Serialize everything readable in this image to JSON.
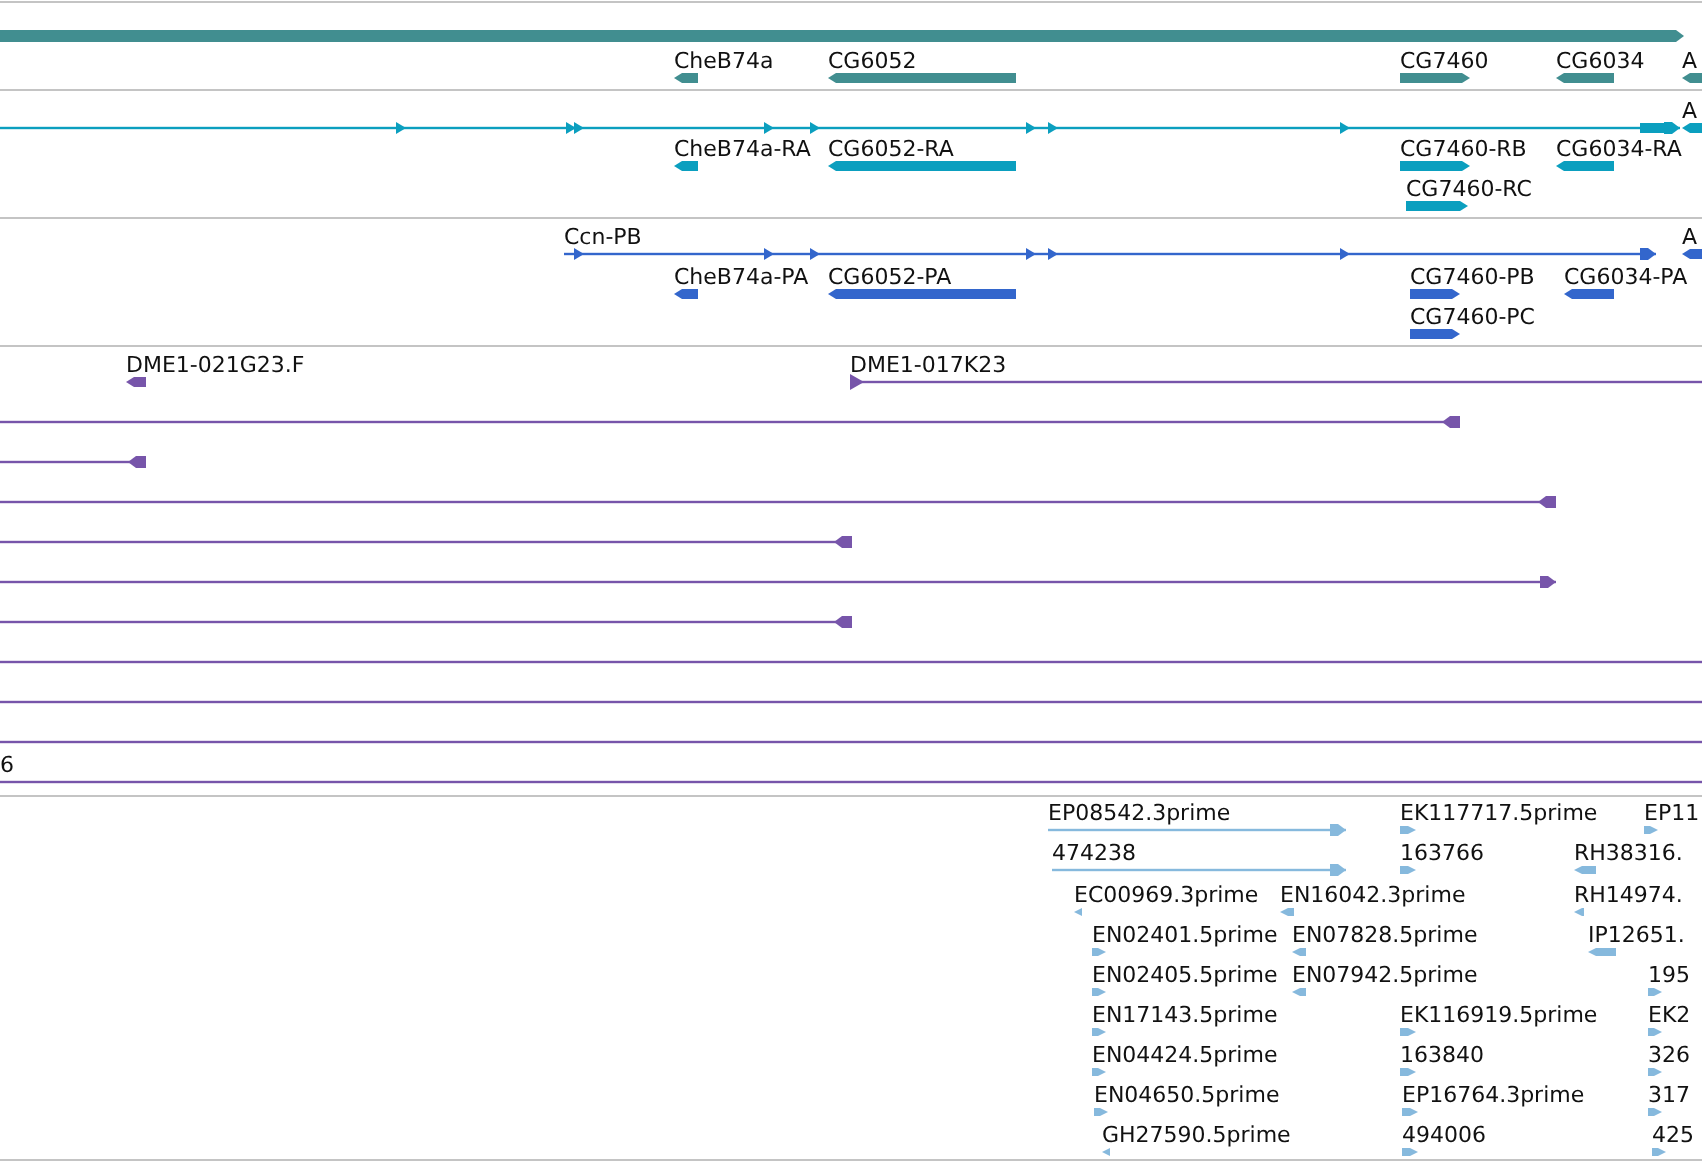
{
  "tracks": [
    {
      "color": "#418e90",
      "features": [
        {
          "kind": "bar",
          "forward": true
        },
        {
          "kind": "bar",
          "label": "CheB74a",
          "forward": false
        },
        {
          "kind": "bar",
          "label": "CG6052",
          "forward": false
        },
        {
          "kind": "bar",
          "label": "CG7460",
          "forward": true
        },
        {
          "kind": "bar",
          "label": "CG6034",
          "forward": false
        },
        {
          "kind": "bar",
          "label": "A",
          "forward": false
        }
      ]
    },
    {
      "color": "#0b9fbf",
      "features": [
        {
          "kind": "line",
          "forward": true
        },
        {
          "kind": "bar",
          "label": "A",
          "forward": false
        },
        {
          "kind": "bar",
          "label": "CheB74a-RA",
          "forward": false
        },
        {
          "kind": "bar",
          "label": "CG6052-RA",
          "forward": false
        },
        {
          "kind": "bar",
          "label": "CG7460-RB",
          "forward": true
        },
        {
          "kind": "bar",
          "label": "CG6034-RA",
          "forward": false
        },
        {
          "kind": "bar",
          "label": "CG7460-RC",
          "forward": true
        }
      ]
    },
    {
      "color": "#3366cc",
      "features": [
        {
          "kind": "line",
          "label": "Ccn-PB",
          "forward": true
        },
        {
          "kind": "bar",
          "label": "A",
          "forward": false
        },
        {
          "kind": "bar",
          "label": "CheB74a-PA",
          "forward": false
        },
        {
          "kind": "bar",
          "label": "CG6052-PA",
          "forward": false
        },
        {
          "kind": "bar",
          "label": "CG7460-PB",
          "forward": true
        },
        {
          "kind": "bar",
          "label": "CG6034-PA",
          "forward": false
        },
        {
          "kind": "bar",
          "label": "CG7460-PC",
          "forward": true
        }
      ]
    },
    {
      "color": "#7755aa",
      "features": [
        {
          "kind": "bar",
          "label": "DME1-021G23.F",
          "forward": false
        },
        {
          "kind": "line",
          "label": "DME1-017K23",
          "forward": true
        },
        {
          "kind": "line",
          "forward": false
        },
        {
          "kind": "line",
          "forward": false
        },
        {
          "kind": "line",
          "forward": false
        },
        {
          "kind": "line",
          "forward": false
        },
        {
          "kind": "line",
          "forward": true
        },
        {
          "kind": "line",
          "forward": false
        },
        {
          "kind": "line"
        },
        {
          "kind": "line"
        },
        {
          "kind": "line"
        },
        {
          "kind": "line",
          "label": "6"
        }
      ]
    },
    {
      "color": "#86b9dd",
      "features": [
        {
          "kind": "line",
          "label": "EP08542.3prime",
          "forward": true
        },
        {
          "kind": "line",
          "label": "474238",
          "forward": true
        },
        {
          "kind": "bar",
          "label": "EC00969.3prime",
          "forward": false
        },
        {
          "kind": "bar",
          "label": "EN16042.3prime",
          "forward": false
        },
        {
          "kind": "bar",
          "label": "EN02401.5prime",
          "forward": true
        },
        {
          "kind": "bar",
          "label": "EN07828.5prime",
          "forward": false
        },
        {
          "kind": "bar",
          "label": "EN02405.5prime",
          "forward": true
        },
        {
          "kind": "bar",
          "label": "EN07942.5prime",
          "forward": false
        },
        {
          "kind": "bar",
          "label": "EN17143.5prime",
          "forward": true
        },
        {
          "kind": "bar",
          "label": "EN04424.5prime",
          "forward": true
        },
        {
          "kind": "bar",
          "label": "EN04650.5prime",
          "forward": true
        },
        {
          "kind": "bar",
          "label": "GH27590.5prime",
          "forward": false
        },
        {
          "kind": "bar",
          "label": "EK117717.5prime",
          "forward": true
        },
        {
          "kind": "bar",
          "label": "163766",
          "forward": true
        },
        {
          "kind": "bar",
          "label": "EK116919.5prime",
          "forward": true
        },
        {
          "kind": "bar",
          "label": "163840",
          "forward": true
        },
        {
          "kind": "bar",
          "label": "EP16764.3prime",
          "forward": true
        },
        {
          "kind": "bar",
          "label": "494006",
          "forward": true
        },
        {
          "kind": "bar",
          "label": "EP11",
          "forward": true
        },
        {
          "kind": "bar",
          "label": "RH38316.",
          "forward": false
        },
        {
          "kind": "bar",
          "label": "RH14974.",
          "forward": false
        },
        {
          "kind": "bar",
          "label": "IP12651.",
          "forward": false
        },
        {
          "kind": "bar",
          "label": "195",
          "forward": true
        },
        {
          "kind": "bar",
          "label": "EK2",
          "forward": true
        },
        {
          "kind": "bar",
          "label": "326",
          "forward": true
        },
        {
          "kind": "bar",
          "label": "317",
          "forward": true
        },
        {
          "kind": "bar",
          "label": "425",
          "forward": true
        }
      ]
    }
  ]
}
